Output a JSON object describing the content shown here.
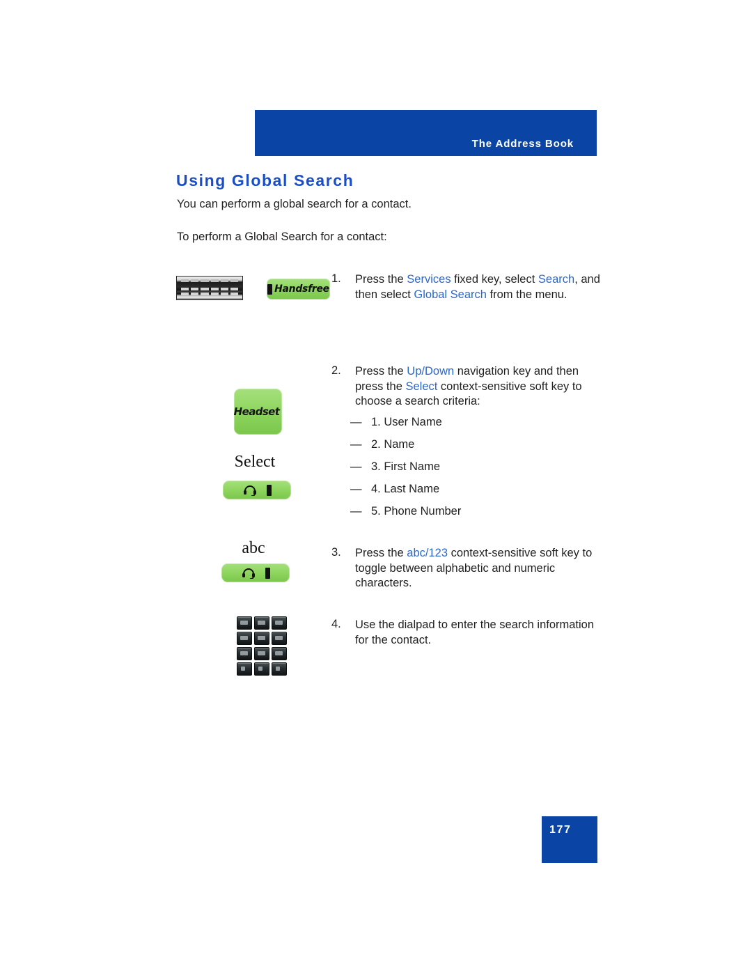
{
  "header": {
    "band_title": "The Address Book",
    "band_color": "#0a45a5"
  },
  "page_title": "Using Global Search",
  "title_color": "#1b4ec4",
  "intro": {
    "line1": "You can perform a global search for a contact.",
    "line2": "To perform a Global Search for a contact:"
  },
  "steps": [
    {
      "number": "1.",
      "segments": [
        {
          "text": "Press the ",
          "style": "plain"
        },
        {
          "text": "Services",
          "style": "term"
        },
        {
          "text": " fixed key, select ",
          "style": "plain"
        },
        {
          "text": "Search",
          "style": "term"
        },
        {
          "text": ", and then select ",
          "style": "plain"
        },
        {
          "text": "Global Search",
          "style": "term"
        },
        {
          "text": " from the menu.",
          "style": "plain"
        }
      ]
    },
    {
      "number": "2.",
      "segments": [
        {
          "text": "Press the ",
          "style": "plain"
        },
        {
          "text": "Up/Down",
          "style": "term"
        },
        {
          "text": " navigation key and then press the ",
          "style": "plain"
        },
        {
          "text": "Select",
          "style": "term"
        },
        {
          "text": " context-sensitive soft key to choose a search criteria:",
          "style": "plain"
        }
      ]
    },
    {
      "number": "3.",
      "segments": [
        {
          "text": "Press the ",
          "style": "plain"
        },
        {
          "text": "abc/123",
          "style": "term"
        },
        {
          "text": " context-sensitive soft key to toggle between alphabetic and numeric characters.",
          "style": "plain"
        }
      ]
    },
    {
      "number": "4.",
      "segments": [
        {
          "text": "Use the dialpad to enter the search information for the contact.",
          "style": "plain"
        }
      ]
    }
  ],
  "criteria": {
    "dash": "—",
    "items": [
      "1. User Name",
      "2. Name",
      "3. First Name",
      "4. Last Name",
      "5. Phone Number"
    ]
  },
  "margin_art": {
    "handsfree_label": "Handsfree",
    "headset_label": "Headset",
    "select_caption": "Select",
    "abc_caption": "abc",
    "softkey_green": "#8cd45c",
    "dialpad_keys": [
      "1",
      "2",
      "3",
      "4",
      "5",
      "6",
      "7",
      "8",
      "9",
      "*",
      "0",
      "#"
    ]
  },
  "footer": {
    "page_number": "177",
    "box_color": "#0a45a5"
  }
}
